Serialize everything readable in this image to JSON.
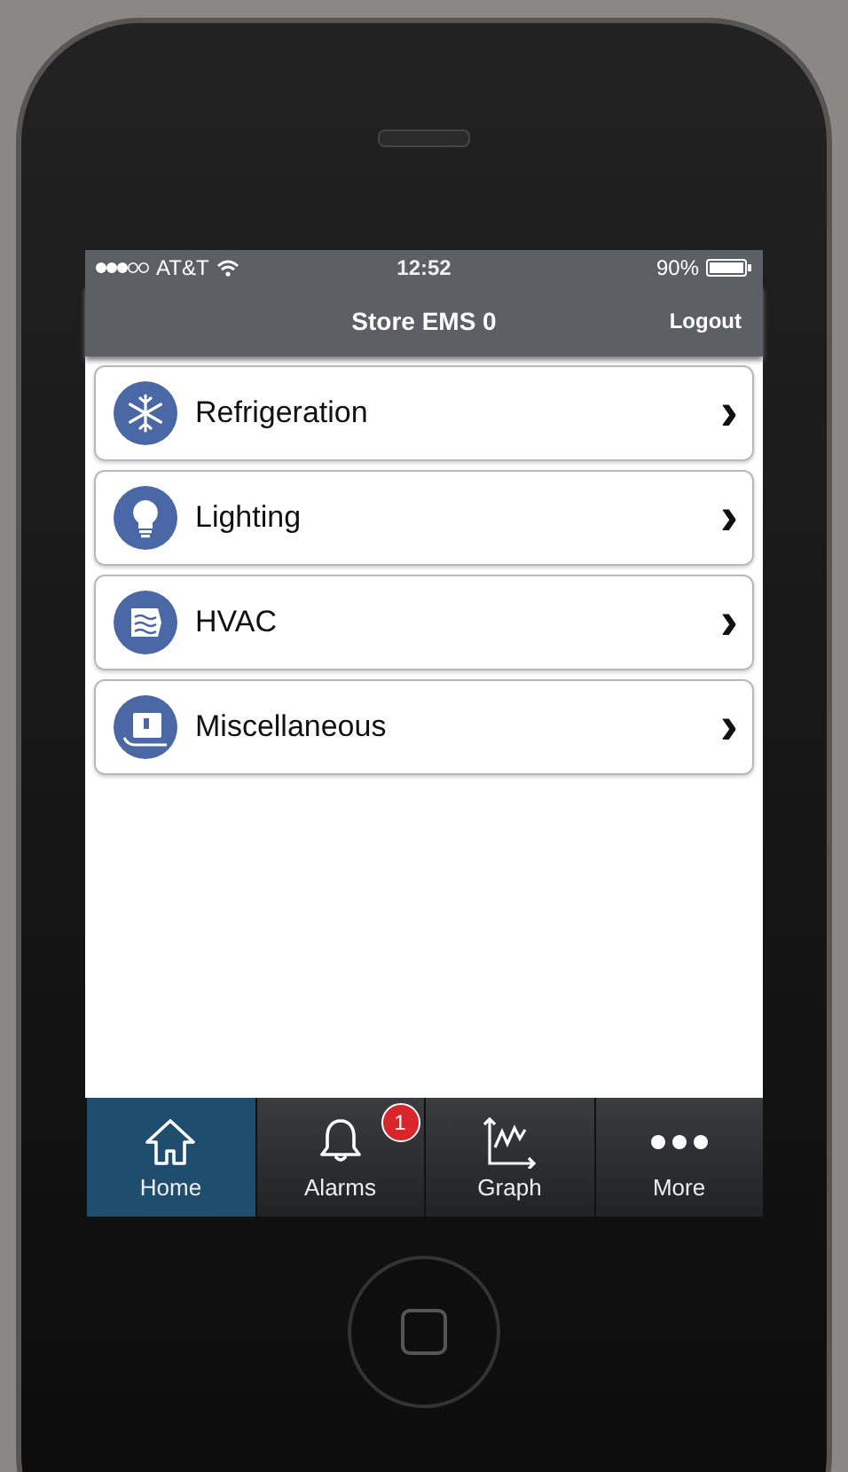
{
  "status_bar": {
    "carrier": "AT&T",
    "time": "12:52",
    "battery": "90%"
  },
  "nav_bar": {
    "title": "Store EMS 0",
    "action": "Logout"
  },
  "menu": [
    {
      "label": "Refrigeration",
      "chevron": "›"
    },
    {
      "label": "Lighting",
      "chevron": "›"
    },
    {
      "label": "HVAC",
      "chevron": "›"
    },
    {
      "label": "Miscellaneous",
      "chevron": "›"
    }
  ],
  "tab_bar": [
    {
      "label": "Home",
      "selected": true
    },
    {
      "label": "Alarms",
      "selected": false,
      "badge": "1"
    },
    {
      "label": "Graph",
      "selected": false
    },
    {
      "label": "More",
      "selected": false
    }
  ]
}
